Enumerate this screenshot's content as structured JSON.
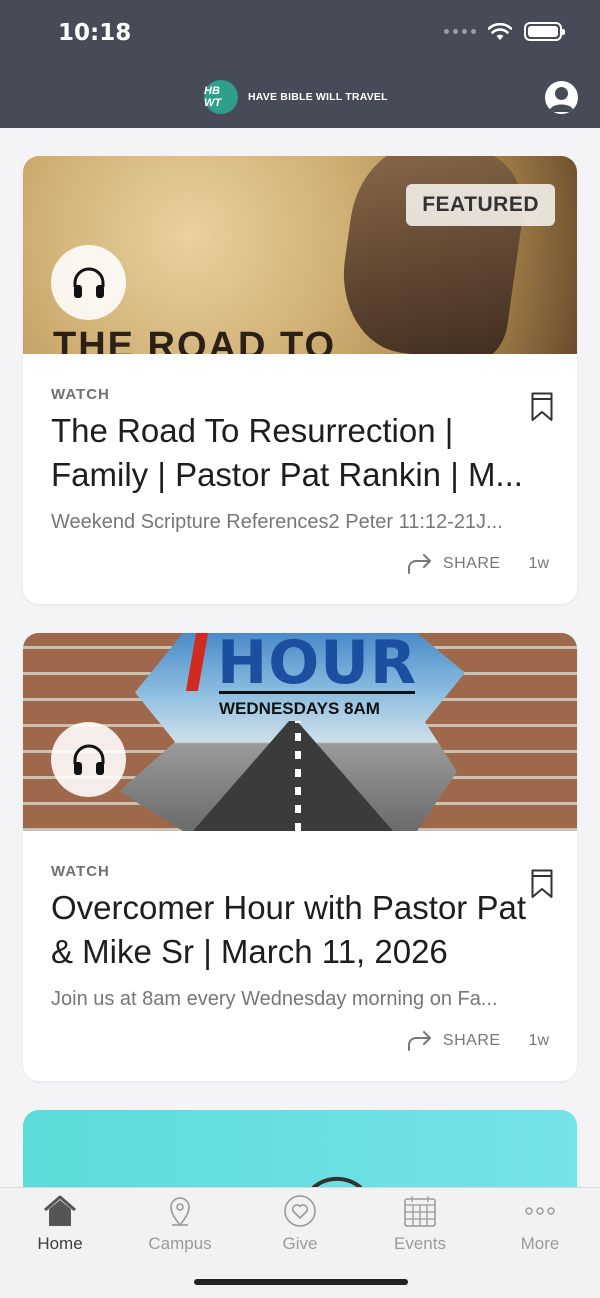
{
  "status": {
    "time": "10:18"
  },
  "header": {
    "logo_text": "HB WT",
    "brand": "HAVE BIBLE WILL TRAVEL"
  },
  "cards": [
    {
      "badge": "FEATURED",
      "image_text": "THE ROAD TO",
      "kind": "WATCH",
      "title": "The Road To Resurrection | Family | Pastor Pat Rankin | M...",
      "description": "Weekend Scripture References2 Peter 11:12-21J...",
      "share_label": "SHARE",
      "age": "1w"
    },
    {
      "image_title": "HOUR",
      "image_subtitle": "WEDNESDAYS 8AM",
      "kind": "WATCH",
      "title": "Overcomer Hour with Pastor Pat & Mike Sr | March 11, 2026",
      "description": "Join us at 8am every Wednesday morning on Fa...",
      "share_label": "SHARE",
      "age": "1w"
    }
  ],
  "tabs": [
    {
      "label": "Home",
      "icon": "home-icon",
      "active": true
    },
    {
      "label": "Campus",
      "icon": "location-pin-icon"
    },
    {
      "label": "Give",
      "icon": "heart-icon"
    },
    {
      "label": "Events",
      "icon": "calendar-icon"
    },
    {
      "label": "More",
      "icon": "more-dots-icon"
    }
  ],
  "colors": {
    "header_bg": "#474b57",
    "logo_bg": "#2f9e8b",
    "page_bg": "#f4f4f6"
  }
}
